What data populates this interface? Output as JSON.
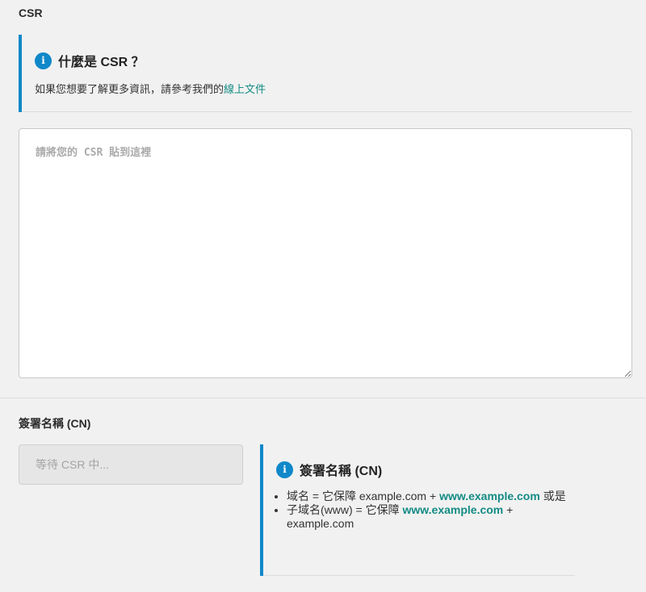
{
  "csr_section": {
    "label": "CSR",
    "info": {
      "title": "什麼是 CSR ？",
      "desc_prefix": "如果您想要了解更多資訊，請參考我們的",
      "desc_link": "線上文件"
    },
    "textarea_placeholder": "請將您的 CSR 貼到這裡"
  },
  "cn_section": {
    "label": "簽署名稱 (CN)",
    "input_placeholder": "等待 CSR 中...",
    "info": {
      "title": "簽署名稱 (CN)",
      "items": [
        {
          "prefix": "域名 = 它保障 example.com + ",
          "highlight": "www.example.com",
          "suffix": " 或是"
        },
        {
          "prefix": "子域名(www) = 它保障 ",
          "highlight": "www.example.com",
          "suffix": " + example.com"
        }
      ]
    }
  },
  "colors": {
    "accent_blue": "#0f88c9",
    "link_teal": "#138b84"
  }
}
